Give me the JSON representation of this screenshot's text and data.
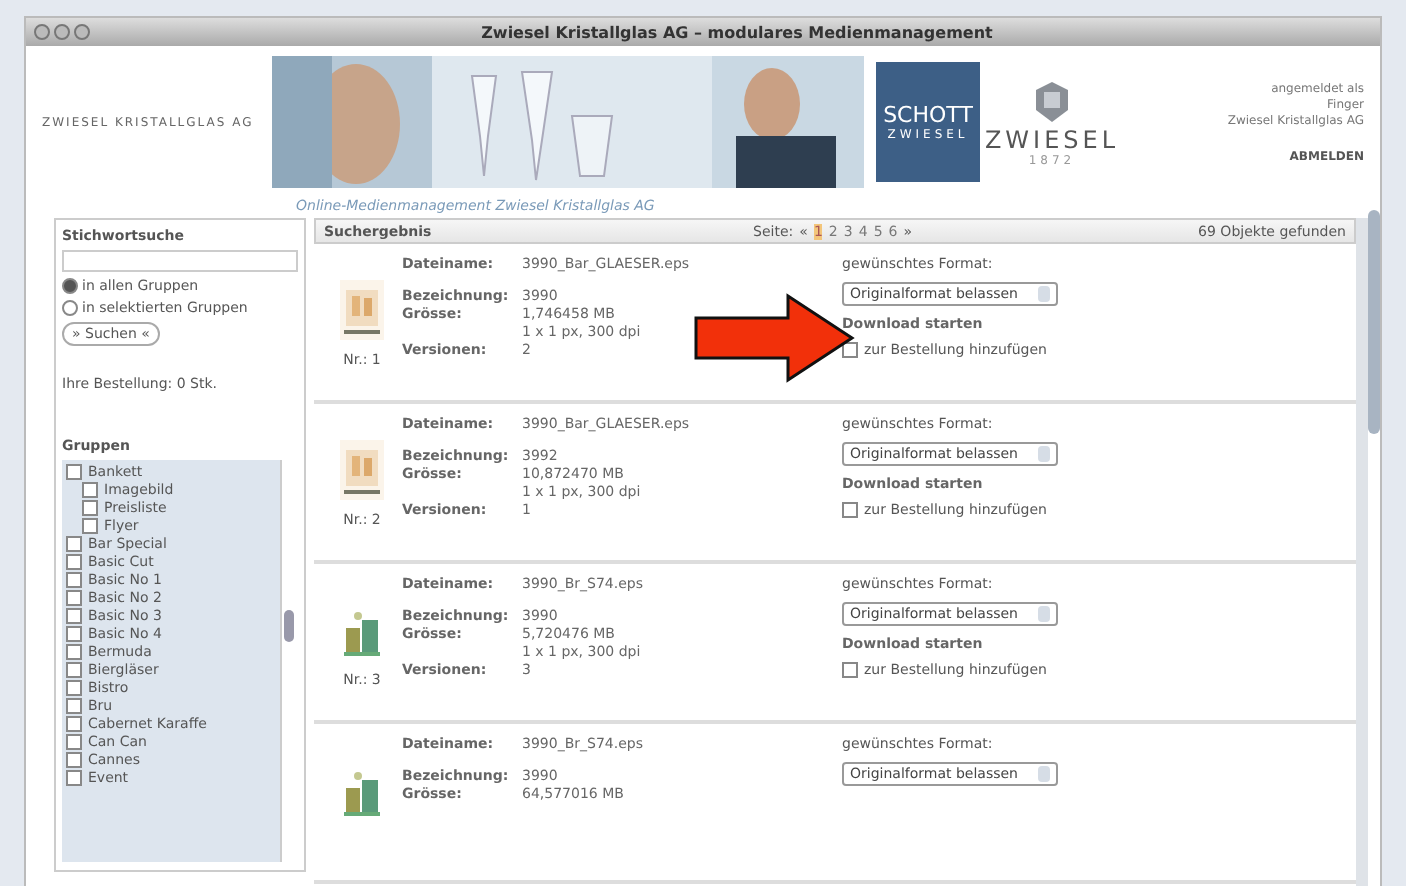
{
  "window": {
    "title": "Zwiesel Kristallglas AG – modulares Medienmanagement"
  },
  "header": {
    "company": "ZWIESEL KRISTALLGLAS AG",
    "banner": {
      "kind": "picture"
    },
    "schott_logo": [
      "SCHOTT",
      "ZWIESEL"
    ],
    "zwiesel_logo": [
      "ZWIESEL",
      "1872"
    ],
    "user": [
      "angemeldet als",
      "Finger",
      "Zwiesel Kristallglas AG"
    ],
    "logout": "ABMELDEN",
    "subtitle": "Online-Medienmanagement Zwiesel Kristallglas AG"
  },
  "sidebar": {
    "search_title": "Stichwortsuche",
    "scopes": [
      {
        "label": "in allen Gruppen",
        "selected": true
      },
      {
        "label": "in selektierten Gruppen",
        "selected": false
      }
    ],
    "search_button": "» Suchen «",
    "order": "Ihre Bestellung: 0 Stk.",
    "groups_title": "Gruppen",
    "groups": [
      {
        "label": "Bankett",
        "checked": false,
        "children": [
          {
            "label": "Imagebild",
            "checked": false
          },
          {
            "label": "Preisliste",
            "checked": false
          },
          {
            "label": "Flyer",
            "checked": false
          }
        ]
      },
      {
        "label": "Bar Special",
        "checked": false
      },
      {
        "label": "Basic Cut",
        "checked": false
      },
      {
        "label": "Basic No 1",
        "checked": false
      },
      {
        "label": "Basic No 2",
        "checked": false
      },
      {
        "label": "Basic No 3",
        "checked": false
      },
      {
        "label": "Basic No 4",
        "checked": false
      },
      {
        "label": "Bermuda",
        "checked": false
      },
      {
        "label": "Biergläser",
        "checked": false
      },
      {
        "label": "Bistro",
        "checked": false
      },
      {
        "label": "Bru",
        "checked": false
      },
      {
        "label": "Cabernet Karaffe",
        "checked": false
      },
      {
        "label": "Can Can",
        "checked": false
      },
      {
        "label": "Cannes",
        "checked": false
      },
      {
        "label": "Event",
        "checked": false
      }
    ]
  },
  "results": {
    "title": "Suchergebnis",
    "page_label": "Seite:",
    "prev": "«",
    "pages": [
      {
        "label": "1",
        "selected": true
      },
      {
        "label": "2",
        "selected": false
      },
      {
        "label": "3",
        "selected": false
      },
      {
        "label": "4",
        "selected": false
      },
      {
        "label": "5",
        "selected": false
      },
      {
        "label": "6",
        "selected": false
      }
    ],
    "next": "»",
    "count": "69 Objekte gefunden",
    "items": [
      {
        "thumb": {
          "kind": "picture"
        },
        "number": "Nr.: 1",
        "fields": [
          {
            "label": "Dateiname:",
            "value": "3990_Bar_GLAESER.eps"
          },
          {
            "label": "Bezeichnung:",
            "value": "3990"
          },
          {
            "label": "Grösse:",
            "value": "1,746458 MB"
          },
          {
            "value": "1 x 1 px, 300 dpi"
          },
          {
            "label": "Versionen:",
            "value": "2"
          }
        ],
        "format_label": "gewünschtes Format:",
        "format": "Originalformat belassen",
        "download": "Download starten",
        "add": {
          "label": "zur Bestellung hinzufügen",
          "checked": false
        }
      },
      {
        "thumb": {
          "kind": "picture"
        },
        "number": "Nr.: 2",
        "fields": [
          {
            "label": "Dateiname:",
            "value": "3990_Bar_GLAESER.eps"
          },
          {
            "label": "Bezeichnung:",
            "value": "3992"
          },
          {
            "label": "Grösse:",
            "value": "10,872470 MB"
          },
          {
            "value": "1 x 1 px, 300 dpi"
          },
          {
            "label": "Versionen:",
            "value": "1"
          }
        ],
        "format_label": "gewünschtes Format:",
        "format": "Originalformat belassen",
        "download": "Download starten",
        "add": {
          "label": "zur Bestellung hinzufügen",
          "checked": false
        }
      },
      {
        "thumb": {
          "kind": "picture"
        },
        "number": "Nr.: 3",
        "fields": [
          {
            "label": "Dateiname:",
            "value": "3990_Br_S74.eps"
          },
          {
            "label": "Bezeichnung:",
            "value": "3990"
          },
          {
            "label": "Grösse:",
            "value": "5,720476 MB"
          },
          {
            "value": "1 x 1 px, 300 dpi"
          },
          {
            "label": "Versionen:",
            "value": "3"
          }
        ],
        "format_label": "gewünschtes Format:",
        "format": "Originalformat belassen",
        "download": "Download starten",
        "add": {
          "label": "zur Bestellung hinzufügen",
          "checked": false
        }
      },
      {
        "thumb": {
          "kind": "picture"
        },
        "fields": [
          {
            "label": "Dateiname:",
            "value": "3990_Br_S74.eps"
          },
          {
            "label": "Bezeichnung:",
            "value": "3990"
          },
          {
            "label": "Grösse:",
            "value": "64,577016 MB"
          }
        ],
        "format_label": "gewünschtes Format:",
        "format": "Originalformat belassen"
      }
    ]
  }
}
